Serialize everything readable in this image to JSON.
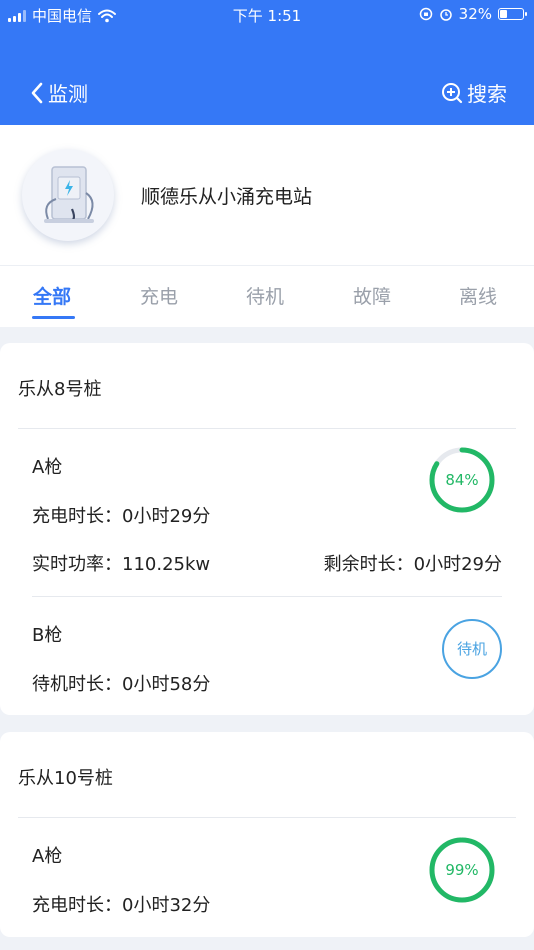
{
  "status_bar": {
    "carrier": "中国电信",
    "time": "下午 1:51",
    "battery": "32%",
    "battery_level": 0.32
  },
  "nav": {
    "back_label": "监测",
    "search_label": "搜索"
  },
  "station": {
    "name": "顺德乐从小涌充电站"
  },
  "tabs": [
    {
      "label": "全部",
      "active": true
    },
    {
      "label": "充电",
      "active": false
    },
    {
      "label": "待机",
      "active": false
    },
    {
      "label": "故障",
      "active": false
    },
    {
      "label": "离线",
      "active": false
    }
  ],
  "piles": [
    {
      "title": "乐从8号桩",
      "guns": [
        {
          "label": "A枪",
          "charge_duration": "充电时长：0小时29分",
          "power": "实时功率：110.25kw",
          "remaining": "剩余时长：0小时29分",
          "progress_label": "84%",
          "progress": 0.84,
          "color": "#22b866"
        },
        {
          "label": "B枪",
          "standby_duration": "待机时长：0小时58分",
          "status": "待机",
          "color": "#4aa3e2"
        }
      ]
    },
    {
      "title": "乐从10号桩",
      "guns": [
        {
          "label": "A枪",
          "charge_duration": "充电时长：0小时32分",
          "progress_label": "99%",
          "progress": 0.99,
          "color": "#22b866"
        }
      ]
    }
  ],
  "colors": {
    "primary": "#3578f6",
    "charging": "#22b866",
    "standby": "#4aa3e2"
  }
}
